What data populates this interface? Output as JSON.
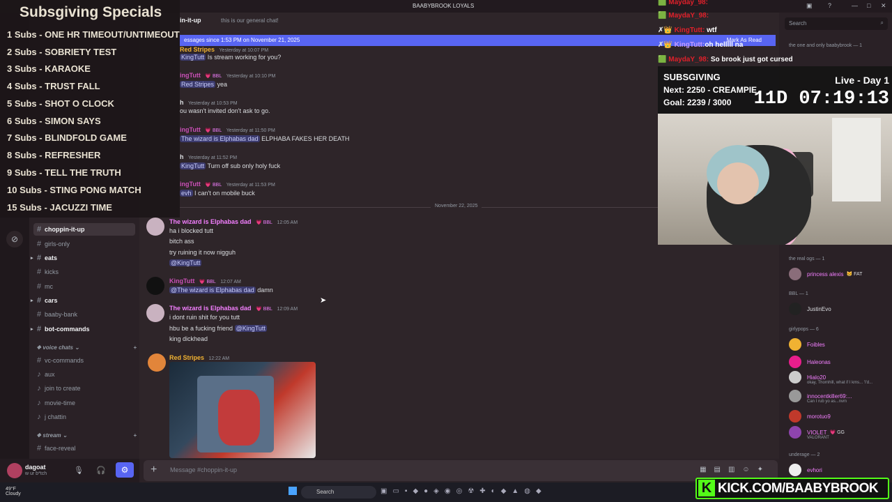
{
  "window": {
    "title": "BAABYBROOK LOYALS",
    "controls": [
      "—",
      "□",
      "✕"
    ]
  },
  "channel_header": {
    "name": "in-it-up",
    "topic": "this is our general chat!"
  },
  "search": {
    "placeholder": "Search"
  },
  "new_messages_bar": {
    "text": "essages since 1:53 PM on November 21, 2025",
    "mark_read": "Mark As Read"
  },
  "messages_before_divider": [
    {
      "user": "Red Stripes",
      "badge": "",
      "time": "Yesterday at 10:07 PM",
      "lines": [
        {
          "mention": "KingTutt",
          "text": " Is stream working for you?"
        }
      ]
    },
    {
      "user": "ingTutt",
      "badge": "💗 BBL",
      "time": "Yesterday at 10:10 PM",
      "lines": [
        {
          "mention": "Red Stripes",
          "text": " yea"
        }
      ]
    },
    {
      "user": "h",
      "badge": "",
      "time": "Yesterday at 10:53 PM",
      "lines": [
        {
          "mention": "",
          "text": "ou wasn't invited don't ask to go."
        }
      ]
    },
    {
      "user": "ingTutt",
      "badge": "💗 BBL",
      "time": "Yesterday at 11:50 PM",
      "lines": [
        {
          "mention": "The wizard is Elphabas dad",
          "text": " ELPHABA FAKES HER DEATH"
        }
      ]
    },
    {
      "user": "h",
      "badge": "",
      "time": "Yesterday at 11:52 PM",
      "lines": [
        {
          "mention": "KingTutt",
          "text": " Turn off sub only holy fuck"
        }
      ]
    },
    {
      "user": "ingTutt",
      "badge": "💗 BBL",
      "time": "Yesterday at 11:53 PM",
      "lines": [
        {
          "mention": "evh",
          "text": " I can't on mobile buck"
        }
      ]
    }
  ],
  "date_divider": "November 22, 2025",
  "messages_after_divider": [
    {
      "user": "The wizard is Elphabas dad",
      "badge": "💗 BBL",
      "time": "12:05 AM",
      "lines": [
        "ha i blocked tutt",
        "bitch ass",
        "try ruining it now nigguh",
        "@KingTutt"
      ]
    },
    {
      "user": "KingTutt",
      "badge": "💗 BBL",
      "time": "12:07 AM",
      "reply": "@The wizard is Elphabas dad",
      "text": " damn"
    },
    {
      "user": "The wizard is Elphabas dad",
      "badge": "💗 BBL",
      "time": "12:09 AM",
      "lines": [
        "i dont ruin shit for you tutt",
        "hbu be a fucking friend ",
        "king dickhead"
      ],
      "mention": "@KingTutt"
    },
    {
      "user": "Red Stripes",
      "badge": "",
      "time": "12:22 AM"
    }
  ],
  "composer": {
    "placeholder": "Message #⁣choppin-it-up"
  },
  "sidebar": {
    "channels": [
      {
        "label": "⁣choppin-it-up",
        "active": true,
        "bold": true,
        "arrow": false
      },
      {
        "label": "girls-only",
        "active": false,
        "bold": false,
        "arrow": false
      },
      {
        "label": "eats",
        "active": false,
        "bold": true,
        "arrow": true
      },
      {
        "label": "kicks",
        "active": false,
        "bold": false,
        "arrow": false
      },
      {
        "label": "mc",
        "active": false,
        "bold": false,
        "arrow": false
      },
      {
        "label": "cars",
        "active": false,
        "bold": true,
        "arrow": true
      },
      {
        "label": "baaby-bank",
        "active": false,
        "bold": false,
        "arrow": false
      },
      {
        "label": "bot-commands",
        "active": false,
        "bold": true,
        "arrow": true
      }
    ],
    "voice_category": "voice chats",
    "voice_channels": [
      "vc-commands",
      "aux",
      "join to create",
      "movie-time",
      "j chattin"
    ],
    "stream_category": "stream",
    "stream_channels": [
      "face-reveal"
    ]
  },
  "user_panel": {
    "name": "dagoat",
    "status": "w ur b*tch"
  },
  "members": {
    "top_group": "the one and only baabybrook — 1",
    "groups": [
      {
        "title": "the real ogs — 1",
        "members": [
          {
            "name": "princess alexis",
            "tag": "😸 FAT",
            "sub": ""
          }
        ]
      },
      {
        "title": "BBL — 1",
        "members": [
          {
            "name": "JustinEvo",
            "tag": "",
            "sub": ""
          }
        ]
      },
      {
        "title": "girlypops — 6",
        "members": [
          {
            "name": "Foibles",
            "tag": "",
            "sub": ""
          },
          {
            "name": "Haleonas",
            "tag": "",
            "sub": ""
          },
          {
            "name": "Hialo20",
            "tag": "",
            "sub": "okay, Thornhill, what if I kms... 'I'd..."
          },
          {
            "name": "innocentkiller69:...",
            "tag": "",
            "sub": "Can I rub yo as...nvm"
          },
          {
            "name": "morotuo9",
            "tag": "",
            "sub": ""
          },
          {
            "name": "VIOLET",
            "tag": "💗 GG",
            "sub": "VALORANT"
          }
        ]
      },
      {
        "title": "underage — 2",
        "members": [
          {
            "name": "evhori",
            "tag": "",
            "sub": ""
          }
        ]
      }
    ]
  },
  "subsgiving": {
    "title": "Subsgiving Specials",
    "items": [
      "1 Subs - ONE HR TIMEOUT/UNTIMEOUT",
      "2 Subs - SOBRIETY TEST",
      "3 Subs - KARAOKE",
      "4 Subs - TRUST FALL",
      "5 Subs - SHOT O CLOCK",
      "6 Subs - SIMON SAYS",
      "7 Subs - BLINDFOLD GAME",
      "8 Subs - REFRESHER",
      "9 Subs - TELL THE TRUTH",
      "10 Subs - STING PONG MATCH",
      "15 Subs - JACUZZI TIME"
    ]
  },
  "kick_chat": [
    {
      "user": "Mayday_98:",
      "text": ""
    },
    {
      "user": "MaydaY_98:",
      "text": ""
    },
    {
      "user": "KingTutt:",
      "text": "wtf"
    },
    {
      "user": "KingTutt:",
      "text": "oh helllll na"
    },
    {
      "user": "MaydaY_98:",
      "text": "So brook just got cursed"
    }
  ],
  "sub_goal": {
    "title": "SUBSGIVING",
    "next": "Next: 2250 - CREAMPIE",
    "goal": "Goal: 2239 / 3000",
    "live": "Live - Day 1",
    "timer": "11D 07:19:13"
  },
  "kick_banner": {
    "logo": "K",
    "text": "KICK.COM/BAABYBROOK"
  },
  "taskbar": {
    "weather_temp": "49°F",
    "weather_desc": "Cloudy",
    "search": "Search"
  },
  "colors": {
    "accent": "#5865f2",
    "kick_green": "#53fc18",
    "mention_pink": "#f47fff"
  }
}
